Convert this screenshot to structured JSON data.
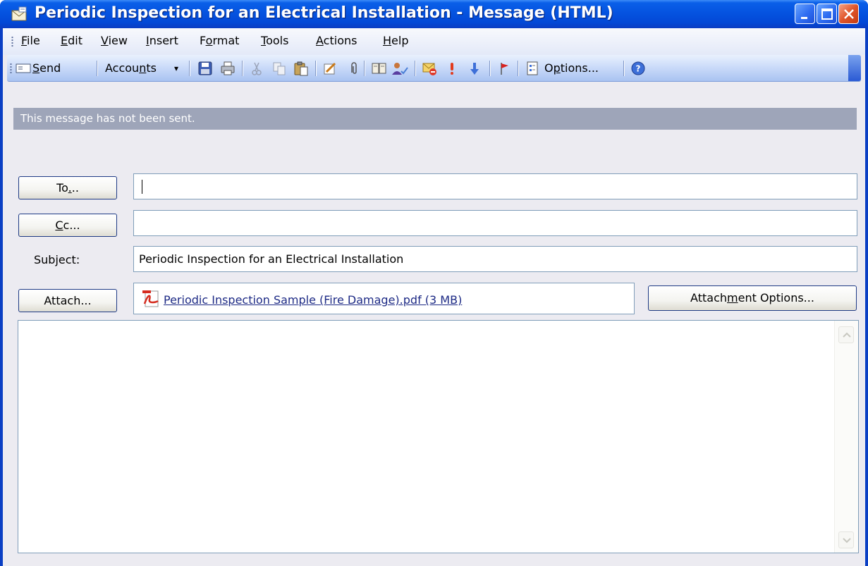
{
  "window": {
    "title": "Periodic Inspection for an Electrical Installation - Message (HTML)"
  },
  "menu": {
    "items": [
      {
        "pre": "",
        "key": "F",
        "post": "ile"
      },
      {
        "pre": "",
        "key": "E",
        "post": "dit"
      },
      {
        "pre": "",
        "key": "V",
        "post": "iew"
      },
      {
        "pre": "",
        "key": "I",
        "post": "nsert"
      },
      {
        "pre": "F",
        "key": "o",
        "post": "rmat"
      },
      {
        "pre": "",
        "key": "T",
        "post": "ools"
      },
      {
        "pre": "",
        "key": "A",
        "post": "ctions"
      },
      {
        "pre": "",
        "key": "H",
        "post": "elp"
      }
    ]
  },
  "toolbar": {
    "send": {
      "pre": "",
      "key": "S",
      "post": "end"
    },
    "accounts": {
      "pre": "Accou",
      "key": "n",
      "post": "ts"
    },
    "accounts_arrow": "▾",
    "options": {
      "pre": "O",
      "key": "p",
      "post": "tions..."
    }
  },
  "infobar": {
    "text": "This message has not been sent."
  },
  "fields": {
    "to_button": {
      "pre": "To",
      "key": ".",
      "post": ".."
    },
    "to_value": "",
    "cc_button": {
      "pre": "",
      "key": "C",
      "post": "c..."
    },
    "cc_value": "",
    "subject_label": {
      "pre": "Sub",
      "key": "j",
      "post": "ect:"
    },
    "subject_value": "Periodic Inspection for an Electrical Installation",
    "attach_button": "Attach...",
    "attachment_name": "Periodic Inspection Sample (Fire Damage).pdf (3 MB)",
    "attachment_options": {
      "pre": "Attach",
      "key": "m",
      "post": "ent Options..."
    }
  },
  "colors": {
    "title_bar": "#0553e0",
    "close_button": "#e0552a",
    "infobar": "#9ea5b9",
    "link": "#1d2a85"
  }
}
